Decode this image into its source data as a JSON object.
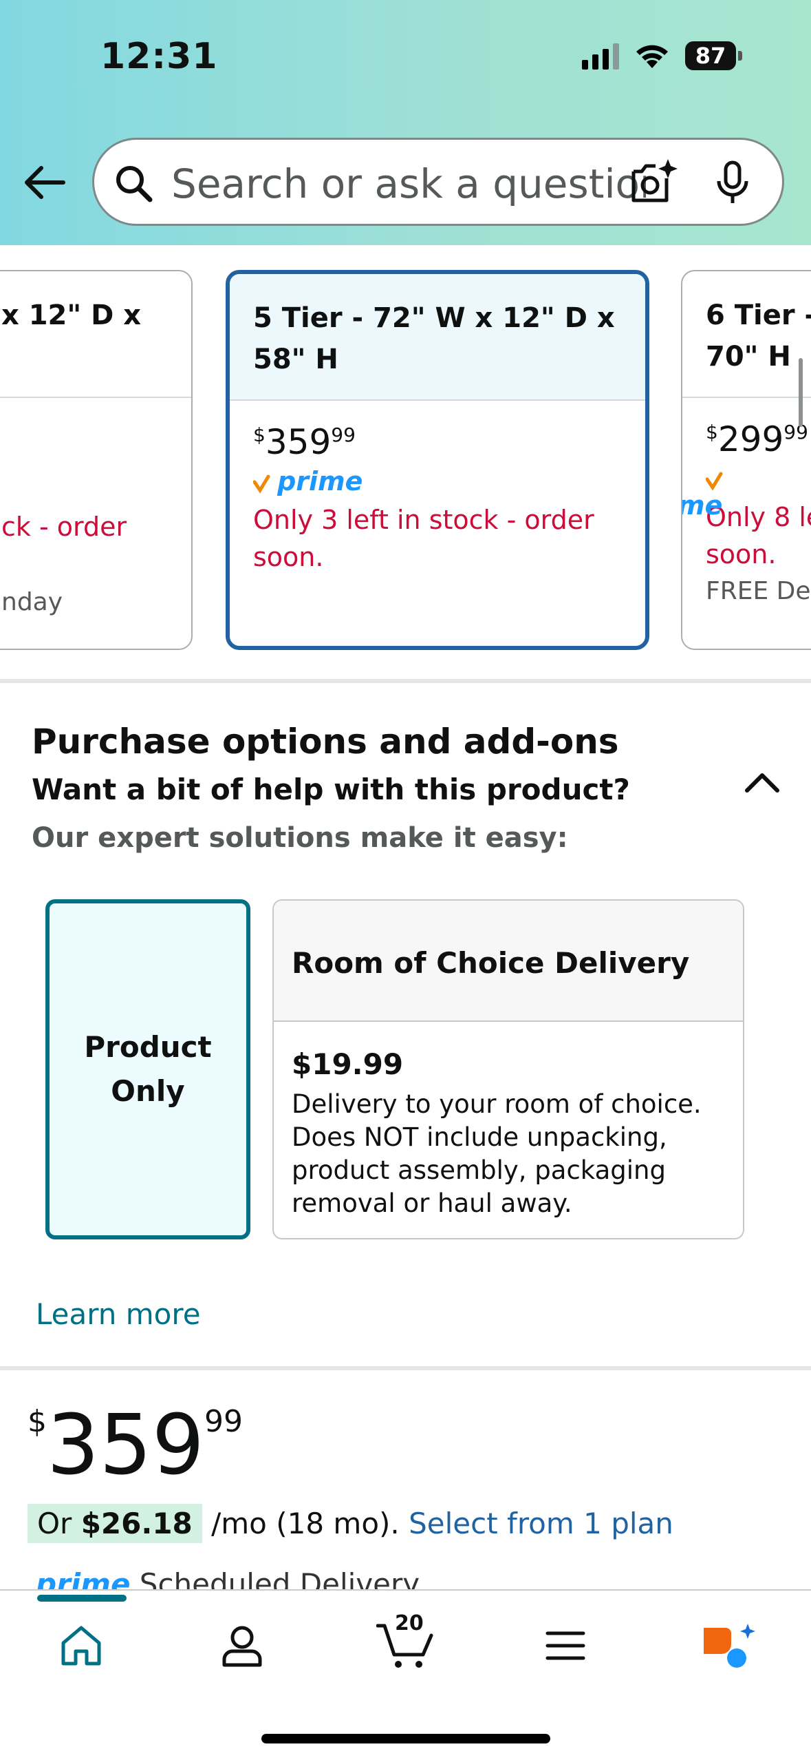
{
  "status_bar": {
    "time": "12:31",
    "battery": "87"
  },
  "search": {
    "placeholder": "Search or ask a question"
  },
  "variants": {
    "left": {
      "title_line1": "x 12\" D x",
      "stock": "ck - order",
      "delivery": "nday"
    },
    "selected": {
      "title_line1": "5 Tier - 72\" W x 12\" D x",
      "title_line2": "58\" H",
      "price_symbol": "$",
      "price_whole": "359",
      "price_cents": "99",
      "prime": "prime",
      "stock_line1": "Only 3 left in stock - order",
      "stock_line2": "soon."
    },
    "right": {
      "title_line1": "6 Tier -",
      "title_line2": "70\" H",
      "price_symbol": "$",
      "price_whole": "299",
      "price_cents": "99",
      "prime": "prime",
      "stock_line1": "Only 8 le",
      "stock_line2": "soon.",
      "delivery": "FREE Del"
    }
  },
  "purchase_options": {
    "title": "Purchase options and add-ons",
    "help": "Want a bit of help with this product?",
    "subtitle": "Our expert solutions make it easy:",
    "product_only_line1": "Product",
    "product_only_line2": "Only",
    "room": {
      "title": "Room of Choice Delivery",
      "price": "$19.99",
      "desc_line1": "Delivery to your room of choice.",
      "desc_line2": "Does NOT include unpacking,",
      "desc_line3": "product assembly, packaging",
      "desc_line4": "removal or haul away."
    },
    "learn_more": "Learn more"
  },
  "price": {
    "symbol": "$",
    "whole": "359",
    "cents": "99",
    "monthly_prefix": "Or ",
    "monthly_amount": "$26.18",
    "monthly_suffix": " /mo (18 mo). ",
    "plan_link": "Select from 1 plan",
    "prime": "prime",
    "scheduled": "Scheduled Delivery"
  },
  "bottom_nav": {
    "cart_count": "20",
    "accent": "#007185"
  },
  "colors": {
    "stock_red": "#cc0c39",
    "selected_border": "#2162a1",
    "teal": "#007185",
    "prime_blue": "#1a98ff",
    "prime_check": "#f08804"
  }
}
